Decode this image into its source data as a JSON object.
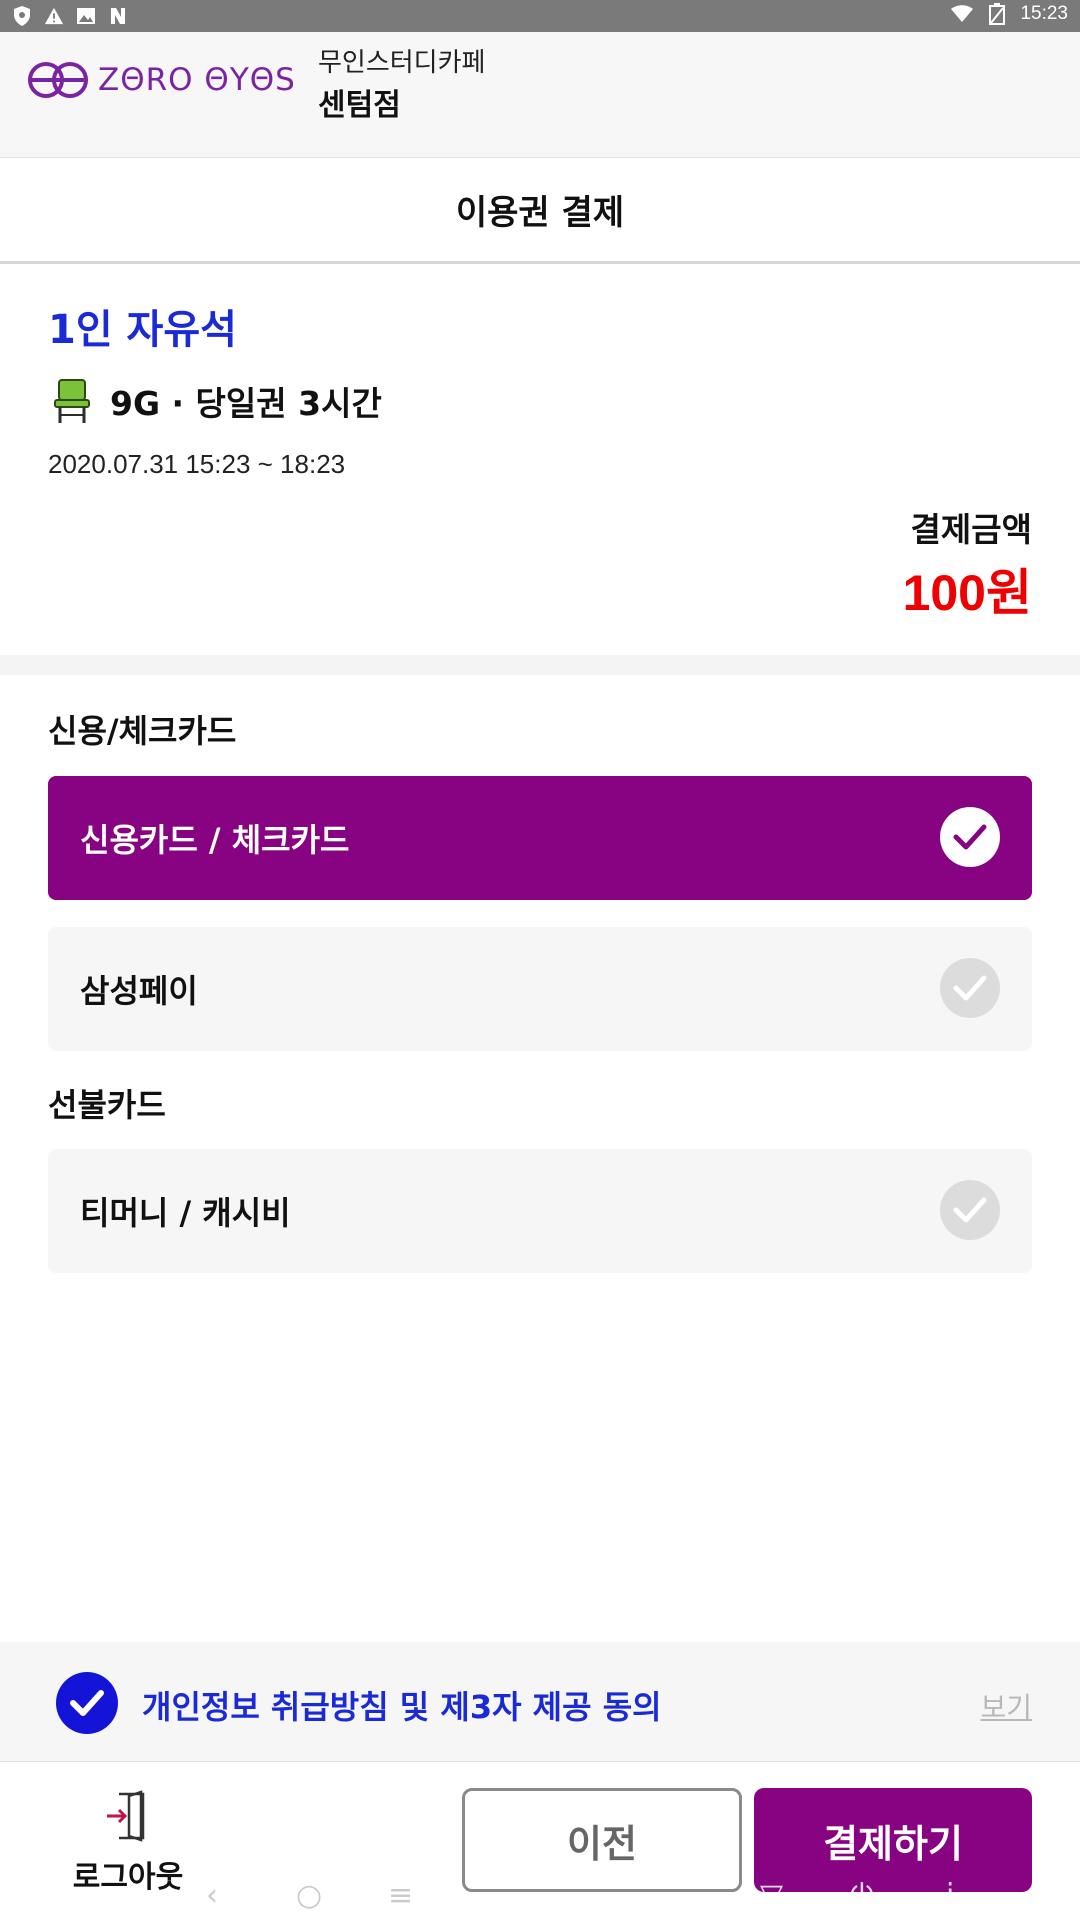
{
  "status_bar": {
    "time": "15:23",
    "left_icons": [
      "shield-icon",
      "warning-icon",
      "image-icon",
      "nfc-icon"
    ],
    "right_icons": [
      "wifi-icon",
      "battery-icon"
    ]
  },
  "header": {
    "logo_text": "ZΘRO ΘYΘS",
    "store_subtitle": "무인스터디카페",
    "store_name": "센텀점"
  },
  "page": {
    "title": "이용권 결제"
  },
  "ticket": {
    "type": "1인 자유석",
    "seat_and_plan": "9G · 당일권 3시간",
    "period": "2020.07.31 15:23 ~ 18:23",
    "amount_label": "결제금액",
    "amount_value": "100원"
  },
  "payment": {
    "credit_section_label": "신용/체크카드",
    "options_credit": [
      {
        "label": "신용카드 / 체크카드",
        "selected": true
      },
      {
        "label": "삼성페이",
        "selected": false
      }
    ],
    "prepaid_section_label": "선불카드",
    "options_prepaid": [
      {
        "label": "티머니 / 캐시비",
        "selected": false
      }
    ]
  },
  "agreement": {
    "text": "개인정보 취급방침 및 제3자 제공 동의",
    "checked": true,
    "view_link": "보기"
  },
  "bottom": {
    "logout_label": "로그아웃",
    "prev_label": "이전",
    "pay_label": "결제하기"
  },
  "colors": {
    "brand_purple": "#880382",
    "accent_blue": "#1a2ad6",
    "amount_red": "#f00000",
    "status_bar": "#7a7a7a"
  }
}
